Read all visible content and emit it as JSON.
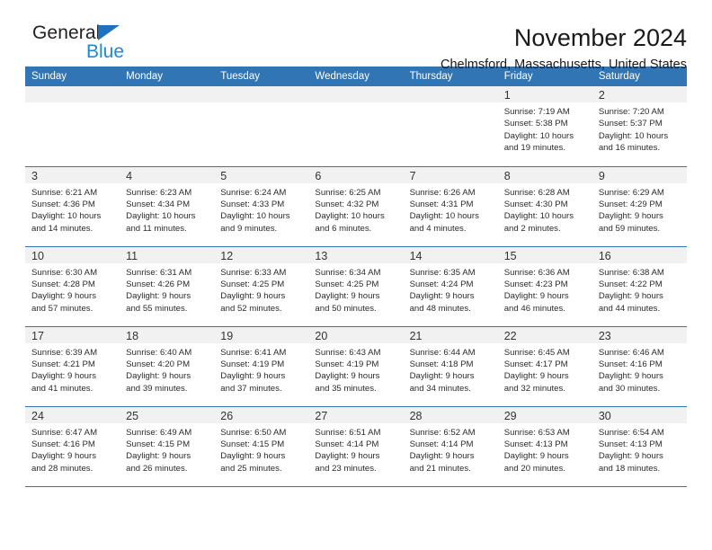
{
  "brand": {
    "name_part1": "General",
    "name_part2": "Blue",
    "logo_icon": "triangle-icon"
  },
  "header": {
    "title": "November 2024",
    "subtitle": "Chelmsford, Massachusetts, United States"
  },
  "theme": {
    "header_blue": "#3175b4",
    "brand_blue": "#2089d6",
    "daynum_band": "#f1f1f1",
    "text": "#2b2b2b"
  },
  "calendar": {
    "weekday_headers": [
      "Sunday",
      "Monday",
      "Tuesday",
      "Wednesday",
      "Thursday",
      "Friday",
      "Saturday"
    ],
    "weeks": [
      [
        {
          "empty": true
        },
        {
          "empty": true
        },
        {
          "empty": true
        },
        {
          "empty": true
        },
        {
          "empty": true
        },
        {
          "day": "1",
          "sunrise": "Sunrise: 7:19 AM",
          "sunset": "Sunset: 5:38 PM",
          "daylight1": "Daylight: 10 hours",
          "daylight2": "and 19 minutes."
        },
        {
          "day": "2",
          "sunrise": "Sunrise: 7:20 AM",
          "sunset": "Sunset: 5:37 PM",
          "daylight1": "Daylight: 10 hours",
          "daylight2": "and 16 minutes."
        }
      ],
      [
        {
          "day": "3",
          "sunrise": "Sunrise: 6:21 AM",
          "sunset": "Sunset: 4:36 PM",
          "daylight1": "Daylight: 10 hours",
          "daylight2": "and 14 minutes."
        },
        {
          "day": "4",
          "sunrise": "Sunrise: 6:23 AM",
          "sunset": "Sunset: 4:34 PM",
          "daylight1": "Daylight: 10 hours",
          "daylight2": "and 11 minutes."
        },
        {
          "day": "5",
          "sunrise": "Sunrise: 6:24 AM",
          "sunset": "Sunset: 4:33 PM",
          "daylight1": "Daylight: 10 hours",
          "daylight2": "and 9 minutes."
        },
        {
          "day": "6",
          "sunrise": "Sunrise: 6:25 AM",
          "sunset": "Sunset: 4:32 PM",
          "daylight1": "Daylight: 10 hours",
          "daylight2": "and 6 minutes."
        },
        {
          "day": "7",
          "sunrise": "Sunrise: 6:26 AM",
          "sunset": "Sunset: 4:31 PM",
          "daylight1": "Daylight: 10 hours",
          "daylight2": "and 4 minutes."
        },
        {
          "day": "8",
          "sunrise": "Sunrise: 6:28 AM",
          "sunset": "Sunset: 4:30 PM",
          "daylight1": "Daylight: 10 hours",
          "daylight2": "and 2 minutes."
        },
        {
          "day": "9",
          "sunrise": "Sunrise: 6:29 AM",
          "sunset": "Sunset: 4:29 PM",
          "daylight1": "Daylight: 9 hours",
          "daylight2": "and 59 minutes."
        }
      ],
      [
        {
          "day": "10",
          "sunrise": "Sunrise: 6:30 AM",
          "sunset": "Sunset: 4:28 PM",
          "daylight1": "Daylight: 9 hours",
          "daylight2": "and 57 minutes."
        },
        {
          "day": "11",
          "sunrise": "Sunrise: 6:31 AM",
          "sunset": "Sunset: 4:26 PM",
          "daylight1": "Daylight: 9 hours",
          "daylight2": "and 55 minutes."
        },
        {
          "day": "12",
          "sunrise": "Sunrise: 6:33 AM",
          "sunset": "Sunset: 4:25 PM",
          "daylight1": "Daylight: 9 hours",
          "daylight2": "and 52 minutes."
        },
        {
          "day": "13",
          "sunrise": "Sunrise: 6:34 AM",
          "sunset": "Sunset: 4:25 PM",
          "daylight1": "Daylight: 9 hours",
          "daylight2": "and 50 minutes."
        },
        {
          "day": "14",
          "sunrise": "Sunrise: 6:35 AM",
          "sunset": "Sunset: 4:24 PM",
          "daylight1": "Daylight: 9 hours",
          "daylight2": "and 48 minutes."
        },
        {
          "day": "15",
          "sunrise": "Sunrise: 6:36 AM",
          "sunset": "Sunset: 4:23 PM",
          "daylight1": "Daylight: 9 hours",
          "daylight2": "and 46 minutes."
        },
        {
          "day": "16",
          "sunrise": "Sunrise: 6:38 AM",
          "sunset": "Sunset: 4:22 PM",
          "daylight1": "Daylight: 9 hours",
          "daylight2": "and 44 minutes."
        }
      ],
      [
        {
          "day": "17",
          "sunrise": "Sunrise: 6:39 AM",
          "sunset": "Sunset: 4:21 PM",
          "daylight1": "Daylight: 9 hours",
          "daylight2": "and 41 minutes."
        },
        {
          "day": "18",
          "sunrise": "Sunrise: 6:40 AM",
          "sunset": "Sunset: 4:20 PM",
          "daylight1": "Daylight: 9 hours",
          "daylight2": "and 39 minutes."
        },
        {
          "day": "19",
          "sunrise": "Sunrise: 6:41 AM",
          "sunset": "Sunset: 4:19 PM",
          "daylight1": "Daylight: 9 hours",
          "daylight2": "and 37 minutes."
        },
        {
          "day": "20",
          "sunrise": "Sunrise: 6:43 AM",
          "sunset": "Sunset: 4:19 PM",
          "daylight1": "Daylight: 9 hours",
          "daylight2": "and 35 minutes."
        },
        {
          "day": "21",
          "sunrise": "Sunrise: 6:44 AM",
          "sunset": "Sunset: 4:18 PM",
          "daylight1": "Daylight: 9 hours",
          "daylight2": "and 34 minutes."
        },
        {
          "day": "22",
          "sunrise": "Sunrise: 6:45 AM",
          "sunset": "Sunset: 4:17 PM",
          "daylight1": "Daylight: 9 hours",
          "daylight2": "and 32 minutes."
        },
        {
          "day": "23",
          "sunrise": "Sunrise: 6:46 AM",
          "sunset": "Sunset: 4:16 PM",
          "daylight1": "Daylight: 9 hours",
          "daylight2": "and 30 minutes."
        }
      ],
      [
        {
          "day": "24",
          "sunrise": "Sunrise: 6:47 AM",
          "sunset": "Sunset: 4:16 PM",
          "daylight1": "Daylight: 9 hours",
          "daylight2": "and 28 minutes."
        },
        {
          "day": "25",
          "sunrise": "Sunrise: 6:49 AM",
          "sunset": "Sunset: 4:15 PM",
          "daylight1": "Daylight: 9 hours",
          "daylight2": "and 26 minutes."
        },
        {
          "day": "26",
          "sunrise": "Sunrise: 6:50 AM",
          "sunset": "Sunset: 4:15 PM",
          "daylight1": "Daylight: 9 hours",
          "daylight2": "and 25 minutes."
        },
        {
          "day": "27",
          "sunrise": "Sunrise: 6:51 AM",
          "sunset": "Sunset: 4:14 PM",
          "daylight1": "Daylight: 9 hours",
          "daylight2": "and 23 minutes."
        },
        {
          "day": "28",
          "sunrise": "Sunrise: 6:52 AM",
          "sunset": "Sunset: 4:14 PM",
          "daylight1": "Daylight: 9 hours",
          "daylight2": "and 21 minutes."
        },
        {
          "day": "29",
          "sunrise": "Sunrise: 6:53 AM",
          "sunset": "Sunset: 4:13 PM",
          "daylight1": "Daylight: 9 hours",
          "daylight2": "and 20 minutes."
        },
        {
          "day": "30",
          "sunrise": "Sunrise: 6:54 AM",
          "sunset": "Sunset: 4:13 PM",
          "daylight1": "Daylight: 9 hours",
          "daylight2": "and 18 minutes."
        }
      ]
    ]
  }
}
